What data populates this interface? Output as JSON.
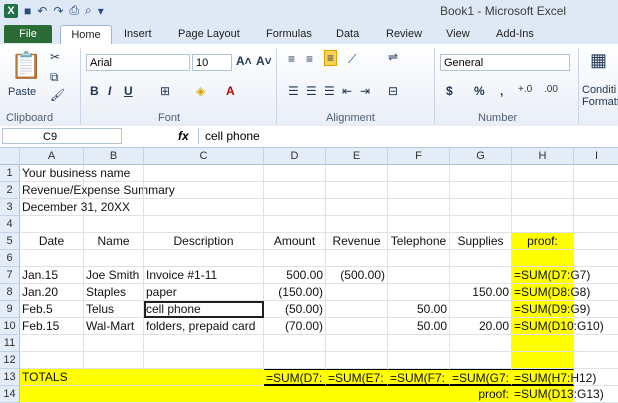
{
  "window_title": "Book1 - Microsoft Excel",
  "tabs": [
    "File",
    "Home",
    "Insert",
    "Page Layout",
    "Formulas",
    "Data",
    "Review",
    "View",
    "Add-Ins"
  ],
  "ribbon": {
    "clipboard": {
      "label": "Clipboard",
      "paste": "Paste"
    },
    "font": {
      "label": "Font",
      "name": "Arial",
      "size": "10"
    },
    "alignment": {
      "label": "Alignment"
    },
    "number": {
      "label": "Number",
      "format": "General",
      "dollar": "$",
      "percent": "%",
      "comma": ","
    },
    "styles": {
      "cond": "Conditi",
      "fmt": "Formatt"
    }
  },
  "formula_bar": {
    "name_box": "C9",
    "fx": "fx",
    "content": "cell phone"
  },
  "columns": [
    "A",
    "B",
    "C",
    "D",
    "E",
    "F",
    "G",
    "H",
    "I"
  ],
  "rows": [
    "1",
    "2",
    "3",
    "4",
    "5",
    "6",
    "7",
    "8",
    "9",
    "10",
    "11",
    "12",
    "13",
    "14"
  ],
  "cells": {
    "A1": "Your business name",
    "A2": "Revenue/Expense Summary",
    "A3": "December 31, 20XX",
    "A5": "Date",
    "B5": "Name",
    "C5": "Description",
    "D5": "Amount",
    "E5": "Revenue",
    "F5": "Telephone",
    "G5": "Supplies",
    "H5": "proof:",
    "A7": "Jan.15",
    "B7": "Joe Smith",
    "C7": "Invoice #1-11",
    "D7": "500.00",
    "E7": "(500.00)",
    "H7": "=SUM(D7:G7)",
    "A8": "Jan.20",
    "B8": "Staples",
    "C8": "paper",
    "D8": "(150.00)",
    "G8": "150.00",
    "H8": "=SUM(D8:G8)",
    "A9": "Feb.5",
    "B9": "Telus",
    "C9": "cell phone",
    "D9": "(50.00)",
    "F9": "50.00",
    "H9": "=SUM(D9:G9)",
    "A10": "Feb.15",
    "B10": "Wal-Mart",
    "C10": "folders, prepaid card",
    "D10": "(70.00)",
    "F10": "50.00",
    "G10": "20.00",
    "H10": "=SUM(D10:G10)",
    "A13": "TOTALS",
    "D13": "=SUM(D7:",
    "E13": "=SUM(E7:",
    "F13": "=SUM(F7:",
    "G13": "=SUM(G7:",
    "H13": "=SUM(H7:H12)",
    "G14": "proof:",
    "H14": "=SUM(D13:G13)"
  },
  "colors": {
    "highlight": "#ffff00",
    "file_tab": "#2a6b36"
  }
}
